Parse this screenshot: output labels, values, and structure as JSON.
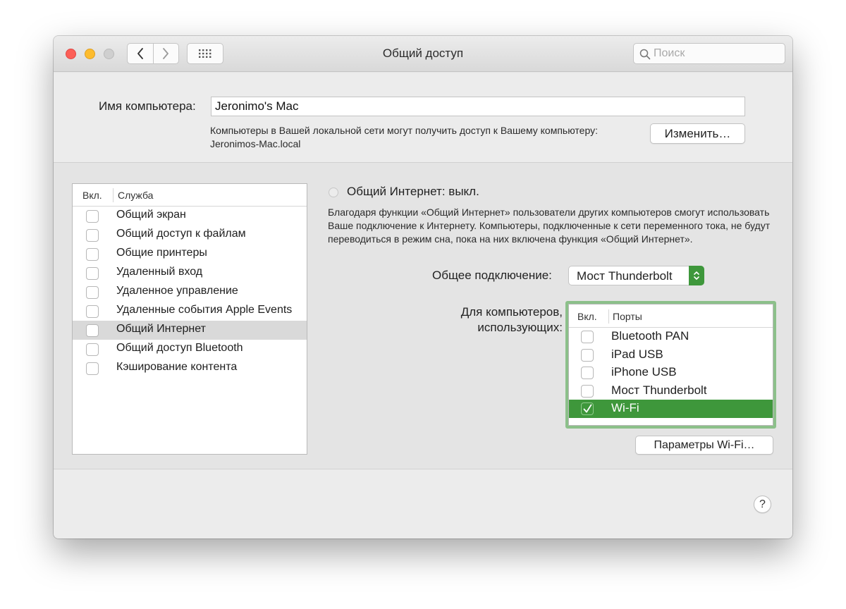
{
  "window": {
    "title": "Общий доступ"
  },
  "search": {
    "placeholder": "Поиск"
  },
  "computer": {
    "label": "Имя компьютера:",
    "name": "Jeronimo's Mac",
    "description": "Компьютеры в Вашей локальной сети могут получить доступ к Вашему компьютеру: Jeronimos-Mac.local",
    "change_button": "Изменить…"
  },
  "services": {
    "col_on": "Вкл.",
    "col_service": "Служба",
    "items": [
      {
        "label": "Общий экран",
        "checked": false,
        "selected": false
      },
      {
        "label": "Общий доступ к файлам",
        "checked": false,
        "selected": false
      },
      {
        "label": "Общие принтеры",
        "checked": false,
        "selected": false
      },
      {
        "label": "Удаленный вход",
        "checked": false,
        "selected": false
      },
      {
        "label": "Удаленное управление",
        "checked": false,
        "selected": false
      },
      {
        "label": "Удаленные события Apple Events",
        "checked": false,
        "selected": false
      },
      {
        "label": "Общий Интернет",
        "checked": false,
        "selected": true
      },
      {
        "label": "Общий доступ Bluetooth",
        "checked": false,
        "selected": false
      },
      {
        "label": "Кэширование контента",
        "checked": false,
        "selected": false
      }
    ]
  },
  "internet_sharing": {
    "status_title": "Общий Интернет: выкл.",
    "description": "Благодаря функции «Общий Интернет» пользователи других компьютеров смогут использовать Ваше подключение к Интернету. Компьютеры, подключенные к сети переменного тока, не будут переводиться в режим сна, пока на них включена функция «Общий Интернет».",
    "shared_connection_label": "Общее подключение:",
    "shared_connection_value": "Мост Thunderbolt",
    "for_computers_label": "Для компьютеров, использующих:",
    "ports": {
      "col_on": "Вкл.",
      "col_ports": "Порты",
      "items": [
        {
          "label": "Bluetooth PAN",
          "checked": false,
          "selected": false
        },
        {
          "label": "iPad USB",
          "checked": false,
          "selected": false
        },
        {
          "label": "iPhone USB",
          "checked": false,
          "selected": false
        },
        {
          "label": "Мост Thunderbolt",
          "checked": false,
          "selected": false
        },
        {
          "label": "Wi-Fi",
          "checked": true,
          "selected": true
        }
      ]
    },
    "wifi_options_button": "Параметры Wi-Fi…"
  },
  "help": {
    "label": "?"
  },
  "colors": {
    "accent": "#3e973b",
    "focus_ring": "#8cc08a",
    "close": "#fc5f57",
    "minimize": "#fdbc2e"
  },
  "icons": [
    "close-icon",
    "minimize-icon",
    "zoom-icon",
    "chevron-left-icon",
    "chevron-right-icon",
    "grid-icon",
    "search-icon",
    "checkmark-icon",
    "stepper-arrows-icon"
  ]
}
